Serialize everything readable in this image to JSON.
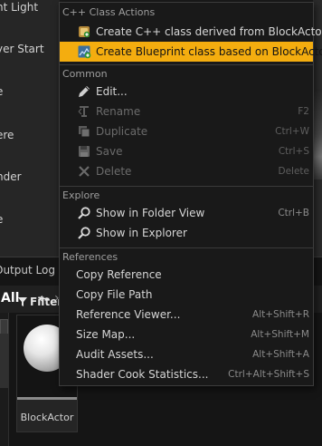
{
  "outliner": {
    "rows": [
      "nt Light",
      "yer Start",
      "e",
      "ere",
      "nder",
      "e"
    ]
  },
  "tabs": {
    "output_log": "Output Log"
  },
  "content_browser": {
    "path_root": "All",
    "filters_label": "Filters",
    "asset_name": "BlockActor"
  },
  "menu": {
    "sections": {
      "cpp": "C++ Class Actions",
      "common": "Common",
      "explore": "Explore",
      "references": "References"
    },
    "items": {
      "create_cpp": "Create C++ class derived from BlockActor",
      "create_bp": "Create Blueprint class based on BlockActor",
      "edit": "Edit...",
      "rename": "Rename",
      "rename_sc": "F2",
      "duplicate": "Duplicate",
      "duplicate_sc": "Ctrl+W",
      "save": "Save",
      "save_sc": "Ctrl+S",
      "delete": "Delete",
      "delete_sc": "Delete",
      "show_folder": "Show in Folder View",
      "show_folder_sc": "Ctrl+B",
      "show_explorer": "Show in Explorer",
      "copy_ref": "Copy Reference",
      "copy_path": "Copy File Path",
      "ref_viewer": "Reference Viewer...",
      "ref_viewer_sc": "Alt+Shift+R",
      "size_map": "Size Map...",
      "size_map_sc": "Alt+Shift+M",
      "audit": "Audit Assets...",
      "audit_sc": "Alt+Shift+A",
      "shader_stats": "Shader Cook Statistics...",
      "shader_stats_sc": "Ctrl+Alt+Shift+S"
    }
  },
  "colors": {
    "highlight": "#f4ad0f",
    "menu_bg": "#191919",
    "disabled_text": "#6b6b6b"
  }
}
